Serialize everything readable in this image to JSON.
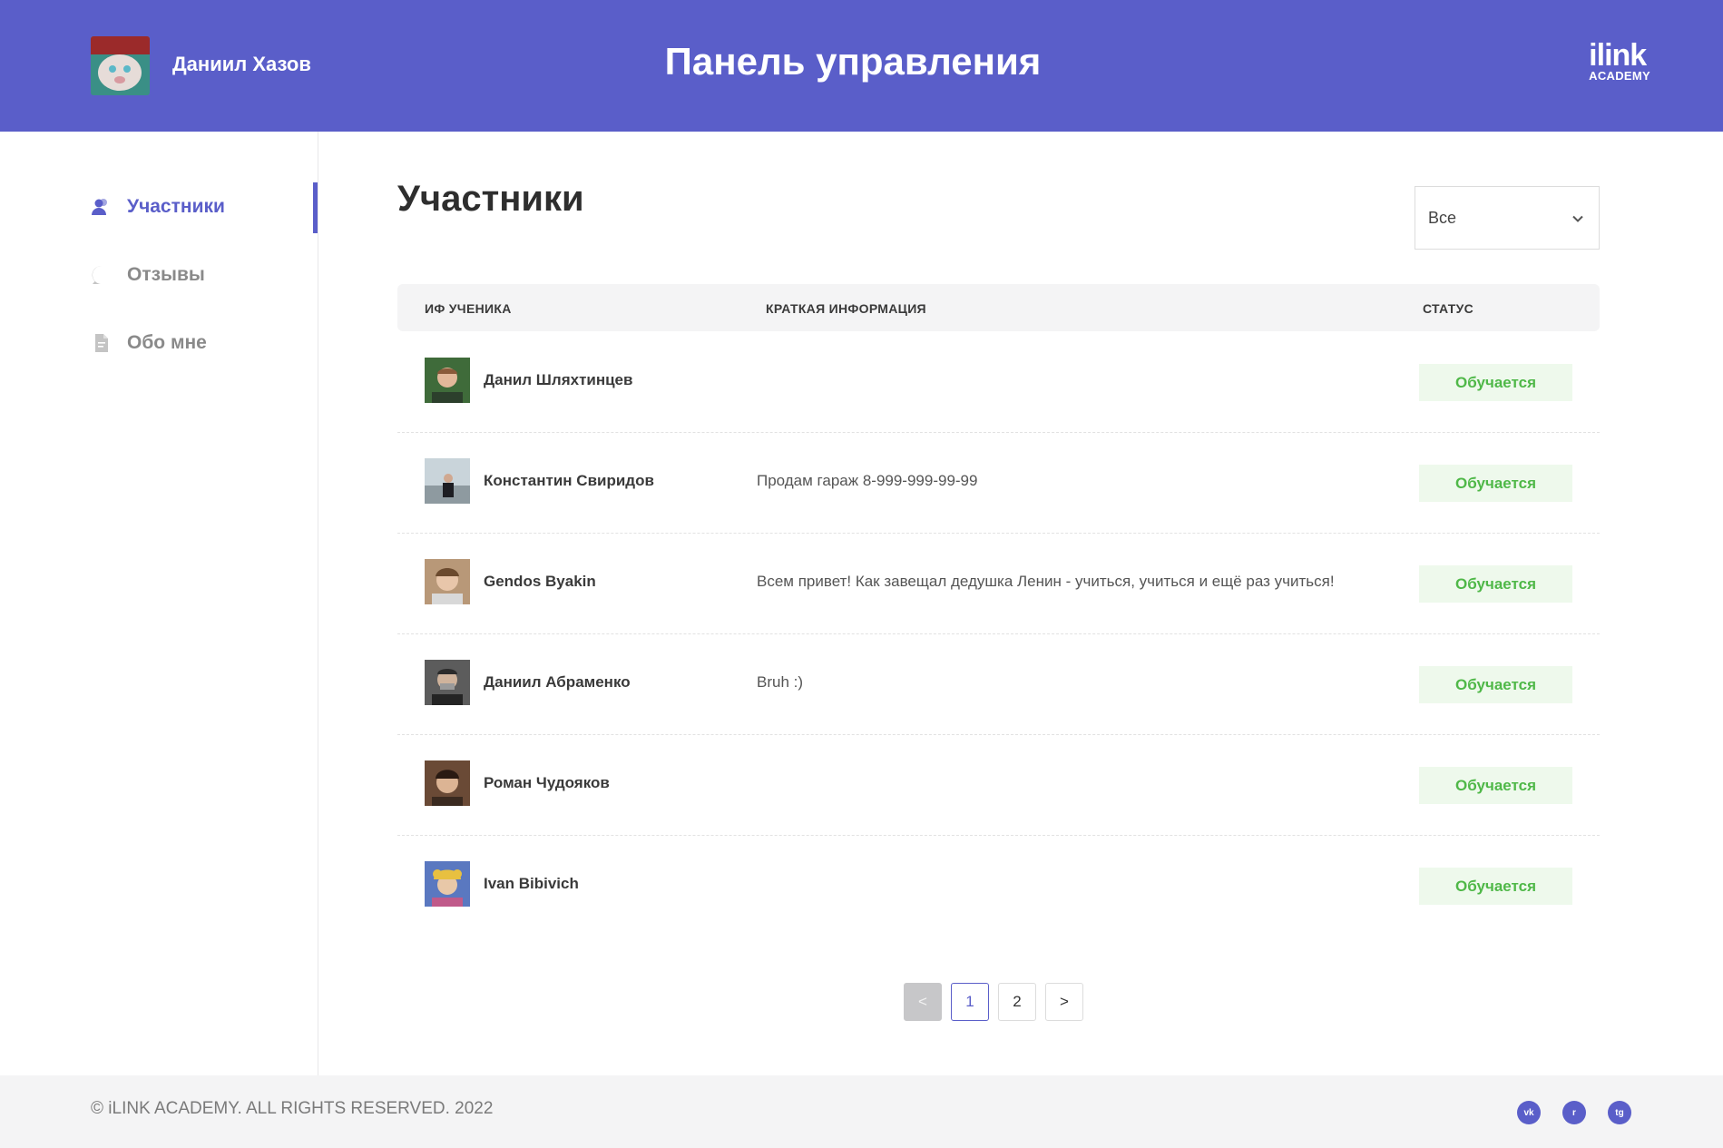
{
  "header": {
    "user_name": "Даниил Хазов",
    "title": "Панель управления",
    "logo_main": "ilink",
    "logo_sub": "ACADEMY"
  },
  "sidebar": {
    "items": [
      {
        "label": "Участники",
        "icon": "users-icon",
        "active": true
      },
      {
        "label": "Отзывы",
        "icon": "chat-bubble-icon",
        "active": false
      },
      {
        "label": "Обо мне",
        "icon": "document-icon",
        "active": false
      }
    ]
  },
  "main": {
    "title": "Участники",
    "filter": {
      "selected": "Все"
    },
    "columns": {
      "name": "ИФ УЧЕНИКА",
      "info": "КРАТКАЯ ИНФОРМАЦИЯ",
      "status": "СТАТУС"
    },
    "rows": [
      {
        "name": "Данил Шляхтинцев",
        "info": "",
        "status": "Обучается"
      },
      {
        "name": "Константин Свиридов",
        "info": "Продам гараж 8-999-999-99-99",
        "status": "Обучается"
      },
      {
        "name": "Gendos Byakin",
        "info": "Всем привет! Как завещал дедушка Ленин - учиться, учиться и ещё раз учиться!",
        "status": "Обучается"
      },
      {
        "name": "Даниил Абраменко",
        "info": "Bruh :)",
        "status": "Обучается"
      },
      {
        "name": "Роман Чудояков",
        "info": "",
        "status": "Обучается"
      },
      {
        "name": "Ivan Bibivich",
        "info": "",
        "status": "Обучается"
      }
    ],
    "pagination": {
      "prev": "<",
      "pages": [
        "1",
        "2"
      ],
      "current": "1",
      "next": ">"
    }
  },
  "footer": {
    "copyright": "© iLINK ACADEMY. ALL RIGHTS RESERVED. 2022",
    "socials": [
      "vk-icon",
      "reddit-icon",
      "telegram-icon"
    ],
    "social_labels": [
      "vk",
      "r",
      "tg"
    ]
  },
  "colors": {
    "accent": "#5a5ec9",
    "status_text": "#4fb848",
    "status_bg": "#eef9ec",
    "footer_bg": "#f4f4f5"
  }
}
